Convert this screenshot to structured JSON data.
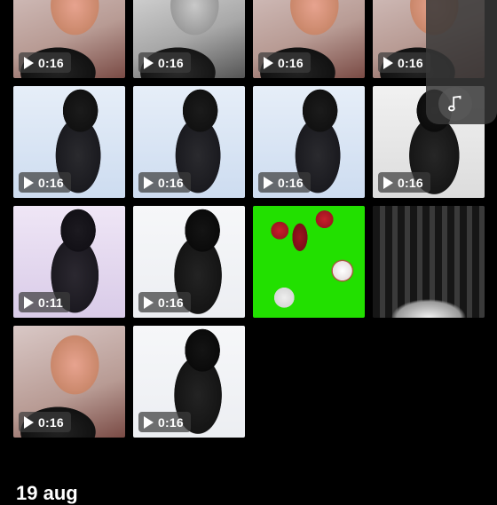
{
  "section_date": "19 aug",
  "videos": [
    {
      "duration": "0:16",
      "theme": "pink-portrait"
    },
    {
      "duration": "0:16",
      "theme": "gray-portrait"
    },
    {
      "duration": "0:16",
      "theme": "pink-portrait"
    },
    {
      "duration": "0:16",
      "theme": "pink-portrait"
    },
    {
      "duration": "0:16",
      "theme": "blue-back"
    },
    {
      "duration": "0:16",
      "theme": "blue-back"
    },
    {
      "duration": "0:16",
      "theme": "blue-back"
    },
    {
      "duration": "0:16",
      "theme": "gray-back"
    },
    {
      "duration": "0:11",
      "theme": "violet-back"
    },
    {
      "duration": "0:16",
      "theme": "white-back"
    },
    {
      "duration": "",
      "theme": "green-screen"
    },
    {
      "duration": "",
      "theme": "stage-group"
    },
    {
      "duration": "0:16",
      "theme": "pink-portrait"
    },
    {
      "duration": "0:16",
      "theme": "white-back"
    }
  ],
  "icons": {
    "play": "play-icon",
    "music": "music-note-icon"
  },
  "colors": {
    "background": "#000000",
    "accent_green": "#22e000",
    "badge": "#3c3c3c"
  }
}
